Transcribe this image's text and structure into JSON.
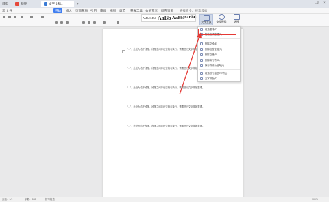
{
  "titlebar": {
    "home_label": "首页",
    "shell_label": "稻壳",
    "doc_tab": "文字文稿1",
    "new_tab": "+",
    "minimize": "–",
    "restore": "❐",
    "close": "×"
  },
  "menubar": {
    "file": "三 文件",
    "items": [
      "开始",
      "插入",
      "页面布局",
      "引用",
      "审阅",
      "视图",
      "章节",
      "开发工具",
      "会员专享",
      "稻壳资源"
    ],
    "search": "查找命令、搜索模板"
  },
  "toolbar": {
    "styles": [
      {
        "sample": "AaBbCcDd",
        "name": "正文"
      },
      {
        "sample": "AaBb",
        "name": "标题1"
      },
      {
        "sample": "AaBbI",
        "name": "标题2"
      },
      {
        "sample": "AaBbC",
        "name": "标题3"
      }
    ],
    "text_tools": {
      "label": "文字工具"
    },
    "find_replace": {
      "label": "查找替换"
    },
    "select": {
      "label": "选择"
    }
  },
  "dropdown": {
    "items": [
      "段落重排(P)",
      "智能格式整理(F)",
      "删除空段(E)",
      "删除段首空格(S)",
      "删除空格(D)",
      "删除换行符(B)",
      "换行符转为回车(L)",
      "段落首行缩进2字符(I)",
      "文字排版(T)"
    ]
  },
  "document": {
    "paragraphs": [
      "“...”，此处为若干段落，段落之间存在空格与换行，需要进行文字排版整理。",
      "“...”，此处为若干段落，段落之间存在空格与换行，需要进行文字排版整理。",
      "“...”，此处为若干段落，段落之间存在空格与换行，需要进行文字排版整理。"
    ]
  },
  "statusbar": {
    "page": "页面：1/1",
    "words": "字数：283",
    "spell": "拼写检查",
    "zoom": "100%"
  }
}
